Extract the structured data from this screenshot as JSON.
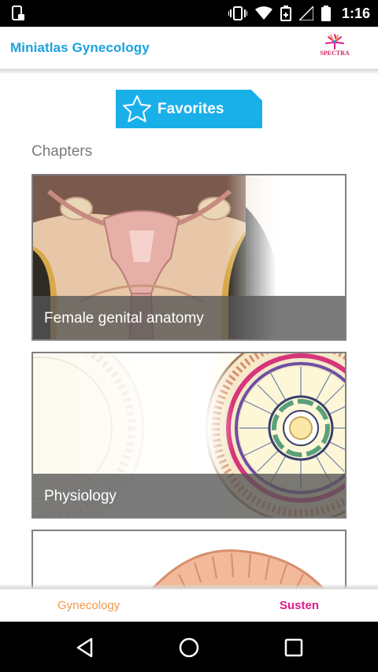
{
  "status_bar": {
    "time": "1:16",
    "icons": [
      "screen-device-icon",
      "vibrate-icon",
      "wifi-icon",
      "signal-icon",
      "battery-saver-icon",
      "no-signal-icon",
      "battery-icon"
    ]
  },
  "app_bar": {
    "title": "Miniatlas Gynecology",
    "logo_text": "SPECTRA"
  },
  "favorites": {
    "label": "Favorites",
    "icon": "star-icon",
    "color": "#19b0ea"
  },
  "chapters": {
    "heading": "Chapters",
    "items": [
      {
        "label": "Female genital anatomy"
      },
      {
        "label": "Physiology"
      },
      {
        "label": ""
      }
    ]
  },
  "bottom_tabs": {
    "items": [
      {
        "label": "Gynecology",
        "color": "#f0994a"
      },
      {
        "label": "Susten",
        "color": "#e0198a"
      }
    ]
  },
  "nav_bar": {
    "icons": [
      "back-icon",
      "home-icon",
      "recents-icon"
    ]
  },
  "colors": {
    "accent": "#1aa3df",
    "caption_overlay": "#555555"
  }
}
